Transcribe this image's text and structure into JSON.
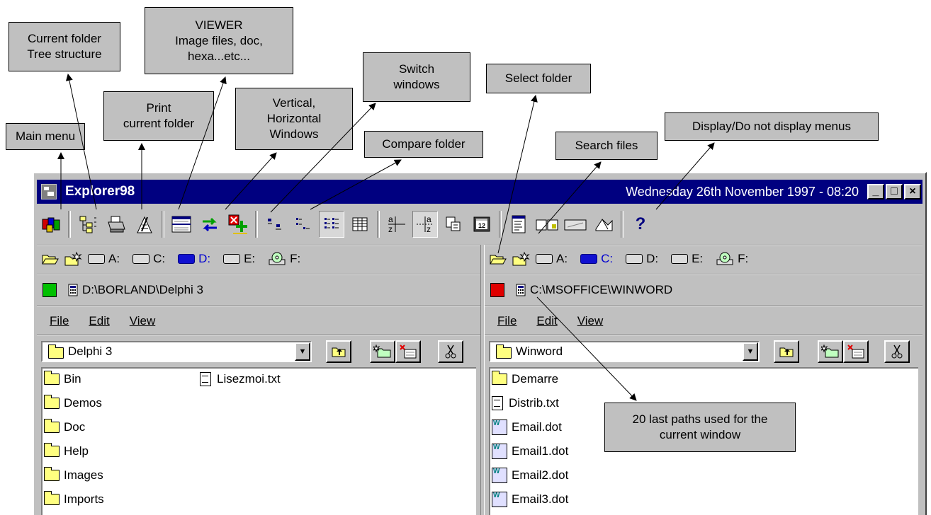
{
  "callouts": {
    "tree": "Current folder\nTree structure",
    "viewer": "VIEWER\nImage files,  doc,\nhexa...etc...",
    "print": "Print\ncurrent folder",
    "main_menu": "Main menu",
    "vertical": "Vertical,\nHorizontal\nWindows",
    "switch": "Switch\nwindows",
    "compare": "Compare folder",
    "select_folder": "Select folder",
    "search": "Search files",
    "display_menus": "Display/Do not display menus",
    "last_paths": "20 last paths used for the\ncurrent window"
  },
  "window": {
    "title": "Explorer98",
    "datetime": "Wednesday 26th November 1997 - 08:20",
    "min": "_",
    "max": "□",
    "close": "×",
    "help": "?"
  },
  "left": {
    "drives": [
      "A:",
      "C:",
      "D:",
      "E:",
      "F:"
    ],
    "active_drive": "D:",
    "status_color": "#00c000",
    "path": "D:\\BORLAND\\Delphi 3",
    "menu": [
      "File",
      "Edit",
      "View"
    ],
    "folder": "Delphi 3",
    "folders": [
      "Bin",
      "Demos",
      "Doc",
      "Help",
      "Images",
      "Imports"
    ],
    "files": [
      "Lisezmoi.txt"
    ]
  },
  "right": {
    "drives": [
      "A:",
      "C:",
      "D:",
      "E:",
      "F:"
    ],
    "active_drive": "C:",
    "status_color": "#e00000",
    "path": "C:\\MSOFFICE\\WINWORD",
    "menu": [
      "File",
      "Edit",
      "View"
    ],
    "folder": "Winword",
    "folders": [
      "Demarre"
    ],
    "files": [
      "Distrib.txt",
      "Email.dot",
      "Email1.dot",
      "Email2.dot",
      "Email3.dot"
    ]
  }
}
